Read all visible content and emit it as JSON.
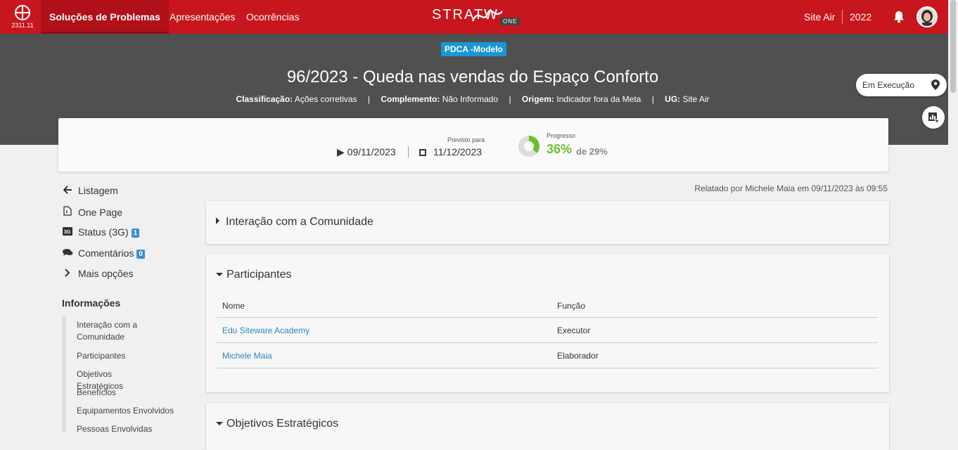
{
  "topbar": {
    "version": "2311.11",
    "nav": [
      "Soluções de Problemas",
      "Apresentações",
      "Ocorrências"
    ],
    "brand": "STRATW",
    "brand_tag": "ONE",
    "unit": "Site Air",
    "year": "2022"
  },
  "hero": {
    "model_badge": "PDCA -Modelo",
    "title": "96/2023 - Queda nas vendas do Espaço Conforto",
    "meta": {
      "classificacao_label": "Classificação:",
      "classificacao": "Ações corretivas",
      "complemento_label": "Complemento:",
      "complemento": "Não Informado",
      "origem_label": "Origem:",
      "origem": "Indicador fora da Meta",
      "ug_label": "UG:",
      "ug": "Site Air"
    },
    "status": "Em Execução"
  },
  "dates": {
    "start": "09/11/2023",
    "forecast_label": "Previsto para",
    "end": "11/12/2023",
    "progress_label": "Progresso",
    "progress_value": "36%",
    "progress_of": "de 29%",
    "progress_fraction": 0.36
  },
  "left_nav": {
    "items": [
      {
        "label": "Listagem"
      },
      {
        "label": "One Page"
      },
      {
        "label": "Status (3G)",
        "count": "1"
      },
      {
        "label": "Comentários",
        "count": "0"
      },
      {
        "label": "Mais opções"
      }
    ],
    "info_title": "Informações",
    "info_links": [
      "Interação com a Comunidade",
      "Participantes",
      "Objetivos Estratégicos",
      "Benefícios",
      "Equipamentos Envolvidos",
      "Pessoas Envolvidas"
    ]
  },
  "reported": "Relatado por Michele Maia em 09/11/2023 às 09:55",
  "panels": {
    "community": "Interação com a Comunidade",
    "participants": {
      "title": "Participantes",
      "headers": [
        "Nome",
        "Função"
      ],
      "rows": [
        {
          "name": "Edu Siteware Academy",
          "role": "Executor"
        },
        {
          "name": "Michele Maia",
          "role": "Elaborador"
        }
      ]
    },
    "objectives": "Objetivos Estratégicos"
  },
  "colors": {
    "topbar": "#c8161e",
    "hero": "#505050",
    "badge": "#1a96d4",
    "progress": "#6bbf2e",
    "link": "#2a86b8"
  }
}
